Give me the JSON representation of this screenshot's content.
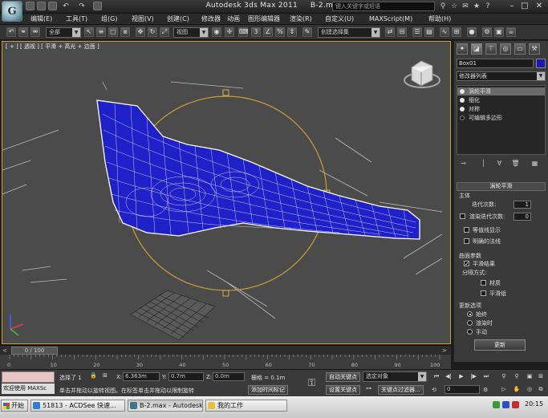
{
  "titlebar": {
    "app_title": "Autodesk 3ds Max  2011",
    "file_name": "B-2.max",
    "search_placeholder": "键入关键字或短语",
    "logo_glyph": "G"
  },
  "menu": [
    "编辑(E)",
    "工具(T)",
    "组(G)",
    "视图(V)",
    "创建(C)",
    "修改器",
    "动画",
    "图形编辑器",
    "渲染(R)",
    "自定义(U)",
    "MAXScript(M)",
    "帮助(H)"
  ],
  "toolbar": {
    "selection_filter": "全部",
    "ref_coord": "视图",
    "named_selection": "创建选择集"
  },
  "viewport": {
    "label": "[ + ] [ 透视 ] [ 平滑 + 高光 + 边面 ]",
    "accent_border": "#d0a020",
    "mesh_color": "#2020c8"
  },
  "command_panel": {
    "object_name": "Box01",
    "object_color": "#1a1ab0",
    "modifier_list": "修改器列表",
    "stack": [
      {
        "label": "涡轮平滑",
        "on": true
      },
      {
        "label": "细化",
        "on": true
      },
      {
        "label": "对称",
        "on": true
      },
      {
        "label": "可编辑多边形",
        "on": false
      }
    ],
    "rollout_title": "涡轮平滑",
    "main_group": "主体",
    "iterations_label": "迭代次数:",
    "iterations_value": "1",
    "render_iters_label": "渲染迭代次数:",
    "render_iters_value": "0",
    "isoline_label": "等值线显示",
    "explicit_normals_label": "明确的法线",
    "surface_group": "曲面参数",
    "smooth_result_label": "平滑结果",
    "separate_by_label": "分隔方式:",
    "materials_label": "材质",
    "smoothing_groups_label": "平滑组",
    "update_group": "更新选项",
    "always_label": "始终",
    "when_rendering_label": "渲染时",
    "manually_label": "手动",
    "update_button": "更新"
  },
  "timeline": {
    "thumb": "0 / 100",
    "ticks": [
      "0",
      "10",
      "20",
      "30",
      "40",
      "50",
      "60",
      "70",
      "80",
      "90",
      "100"
    ]
  },
  "status": {
    "maxscript_label": "欢迎使用 MAXSc",
    "selected": "选择了 1",
    "x_label": "X:",
    "x_value": "6.363m",
    "y_label": "Y:",
    "y_value": "0.7m",
    "z_label": "Z:",
    "z_value": "0.0m",
    "grid": "栅格 = 0.1m",
    "auto_key": "自动关键点",
    "selected_obj": "选定对象",
    "set_key": "设置关键点",
    "key_filters": "关键点过滤器...",
    "frame": "0",
    "prompt": "单击并拖动以旋转视图。在标签单击并拖动以限制旋转",
    "add_time_tag": "添加时间标记"
  },
  "taskbar": {
    "start": "开始",
    "tasks": [
      "51813 - ACDSee 快速...",
      "B-2.max - Autodesk ...",
      "我的工作"
    ],
    "clock": "20:15"
  }
}
